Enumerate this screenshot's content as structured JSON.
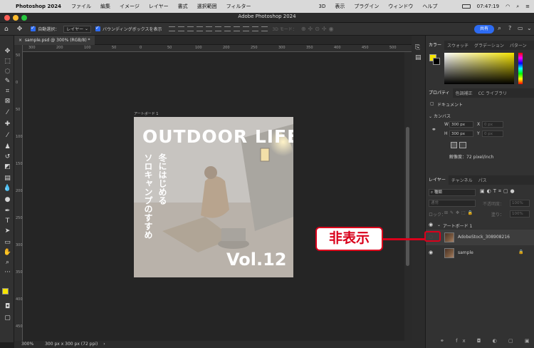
{
  "menubar": {
    "app": "Photoshop 2024",
    "items": [
      "ファイル",
      "編集",
      "イメージ",
      "レイヤー",
      "書式",
      "選択範囲",
      "フィルター",
      "3D",
      "表示",
      "プラグイン",
      "ウィンドウ",
      "ヘルプ"
    ],
    "time": "07:47:19",
    "status_icons": [
      "battery-icon",
      "wifi-icon",
      "search-icon",
      "control-center-icon"
    ]
  },
  "window": {
    "title": "Adobe Photoshop 2024"
  },
  "options": {
    "auto_select_label": "自動選択：",
    "auto_select_value": "レイヤー",
    "bounding_box_label": "バウンディングボックスを表示",
    "mode_3d_label": "3D モード：",
    "share_label": "共有"
  },
  "doc_tab": {
    "label": "sample.psd @ 300% (RGB/8) *"
  },
  "rulers": {
    "h": [
      "300",
      "200",
      "100",
      "50",
      "0",
      "50",
      "100",
      "200",
      "250",
      "300",
      "350",
      "400",
      "450",
      "500"
    ],
    "v": [
      "50",
      "0",
      "50",
      "100",
      "150",
      "200",
      "250",
      "300",
      "350",
      "400",
      "450"
    ]
  },
  "artboard": {
    "label": "アートボード 1",
    "title": "OUTDOOR LIFE",
    "vertical_line1": "冬にはじめる",
    "vertical_line2": "ソロキャンプのすすめ",
    "vol": "Vol.12"
  },
  "status": {
    "zoom": "300%",
    "doc_info": "300 px x 300 px (72 ppi)"
  },
  "color_panel": {
    "tabs": [
      "カラー",
      "スウォッチ",
      "グラデーション",
      "パターン"
    ],
    "fg_color": "#f5e400",
    "bg_color": "#000000"
  },
  "properties_panel": {
    "tabs": [
      "プロパティ",
      "色調補正",
      "CC ライブラリ"
    ],
    "type": "ドキュメント",
    "section": "カンバス",
    "w_label": "W",
    "w_value": "300 px",
    "h_label": "H",
    "h_value": "300 px",
    "x_label": "X",
    "x_value": "0 px",
    "y_label": "Y",
    "y_value": "0 px",
    "resolution": "解像度：72 pixel/inch"
  },
  "layers_panel": {
    "tabs": [
      "レイヤー",
      "チャンネル",
      "パス"
    ],
    "filter_label": "種類",
    "blend_mode": "通常",
    "opacity_label": "不透明度：",
    "opacity_value": "100%",
    "lock_label": "ロック：",
    "fill_label": "塗り：",
    "fill_value": "100%",
    "group": "アートボード 1",
    "layers": [
      {
        "name": "AdobeStock_308908216",
        "visible": false
      },
      {
        "name": "sample",
        "visible": true,
        "locked": true
      }
    ]
  },
  "annotation": {
    "label": "非表示",
    "color": "#d9001b"
  }
}
